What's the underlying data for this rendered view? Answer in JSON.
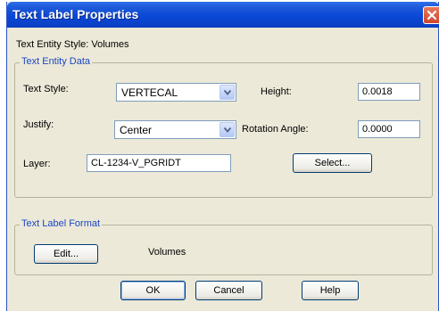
{
  "window": {
    "title": "Text Label Properties"
  },
  "entity_style_text": "Text Entity Style: Volumes",
  "text_entity_data": {
    "group_title": "Text Entity Data",
    "text_style_label": "Text Style:",
    "text_style_value": "VERTECAL",
    "justify_label": "Justify:",
    "justify_value": "Center",
    "layer_label": "Layer:",
    "layer_value": "CL-1234-V_PGRIDT",
    "height_label": "Height:",
    "height_value": "0.0018",
    "rotation_label": "Rotation Angle:",
    "rotation_value": "0.0000",
    "select_button": "Select..."
  },
  "text_label_format": {
    "group_title": "Text Label Format",
    "edit_button": "Edit...",
    "format_value": "Volumes"
  },
  "buttons": {
    "ok": "OK",
    "cancel": "Cancel",
    "help": "Help"
  },
  "icons": {
    "close": "close-icon",
    "dropdown": "chevron-down-icon"
  },
  "colors": {
    "titlebar": "#0a48d6",
    "dialog_bg": "#ece9d8",
    "group_title": "#1c46c4",
    "close_button": "#d0452c"
  }
}
